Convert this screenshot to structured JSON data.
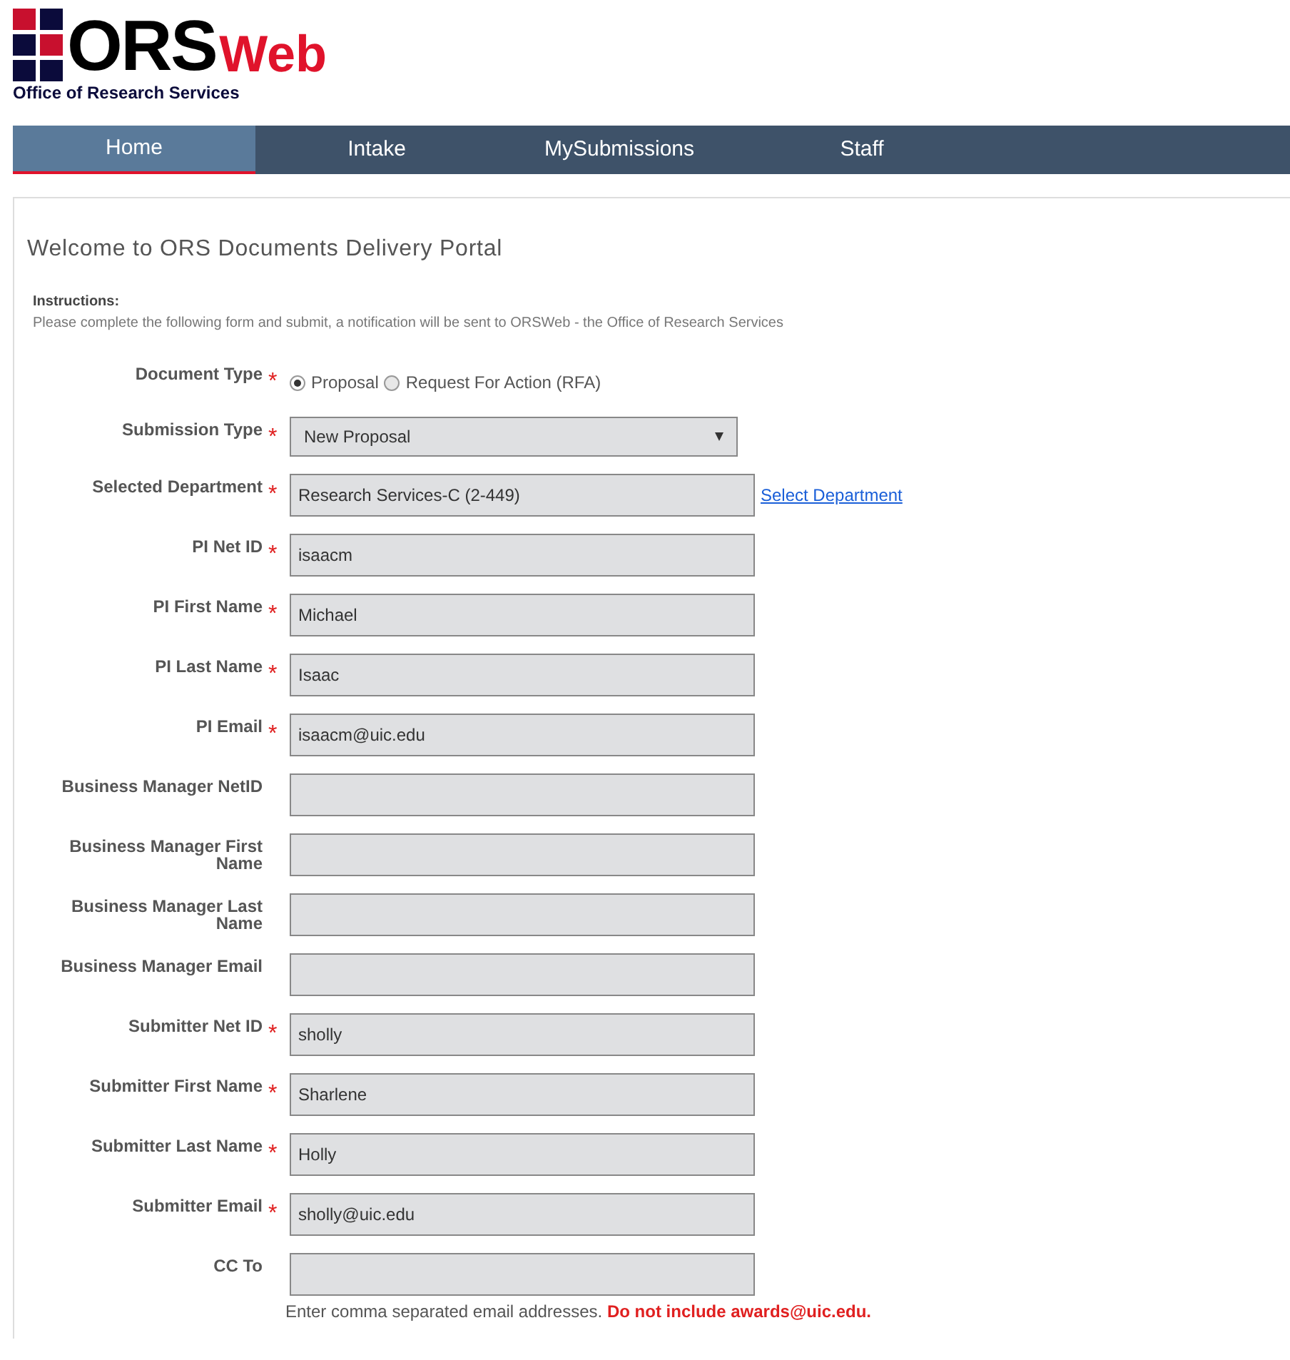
{
  "header": {
    "logo_main": "ORS",
    "logo_accent": "Web",
    "subtitle": "Office of Research Services"
  },
  "nav": [
    {
      "label": "Home",
      "selected": true
    },
    {
      "label": "Intake",
      "selected": false
    },
    {
      "label": "MySubmissions",
      "selected": false
    },
    {
      "label": "Staff",
      "selected": false
    }
  ],
  "page_title": "Welcome to ORS Documents Delivery Portal",
  "instructions": {
    "heading": "Instructions:",
    "text": "Please complete the following form and submit, a notification will be sent to ORSWeb - the Office of Research Services"
  },
  "fields": [
    {
      "kind": "radio",
      "label": "Document Type",
      "required_mark": "*",
      "options": [
        {
          "label": "Proposal",
          "selected": true
        },
        {
          "label": "Request For Action (RFA)",
          "selected": false
        }
      ]
    },
    {
      "kind": "select",
      "label": "Submission Type",
      "required_mark": "*",
      "value": "New Proposal"
    },
    {
      "kind": "text",
      "label": "Selected Department",
      "required_mark": "*",
      "value": "Research Services-C (2-449)",
      "link": "Select Department"
    },
    {
      "kind": "text",
      "label": "PI Net ID",
      "required_mark": "*",
      "value": "isaacm"
    },
    {
      "kind": "text",
      "label": "PI First Name",
      "required_mark": "*",
      "value": "Michael"
    },
    {
      "kind": "text",
      "label": "PI Last Name",
      "required_mark": "*",
      "value": "Isaac"
    },
    {
      "kind": "text",
      "label": "PI Email",
      "required_mark": "*",
      "value": "isaacm@uic.edu"
    },
    {
      "kind": "text",
      "label": "Business Manager NetID"
    },
    {
      "kind": "text",
      "label": "Business Manager First Name"
    },
    {
      "kind": "text",
      "label": "Business Manager Last Name"
    },
    {
      "kind": "text",
      "label": "Business Manager Email"
    },
    {
      "kind": "text",
      "label": "Submitter Net ID",
      "required_mark": "*",
      "value": "sholly"
    },
    {
      "kind": "text",
      "label": "Submitter First Name",
      "required_mark": "*",
      "value": "Sharlene"
    },
    {
      "kind": "text",
      "label": "Submitter Last Name",
      "required_mark": "*",
      "value": "Holly"
    },
    {
      "kind": "text",
      "label": "Submitter Email",
      "required_mark": "*",
      "value": "sholly@uic.edu"
    },
    {
      "kind": "text",
      "label": "CC To",
      "hint": "Enter comma separated email addresses.",
      "warning": "Do not include awards@uic.edu."
    }
  ]
}
